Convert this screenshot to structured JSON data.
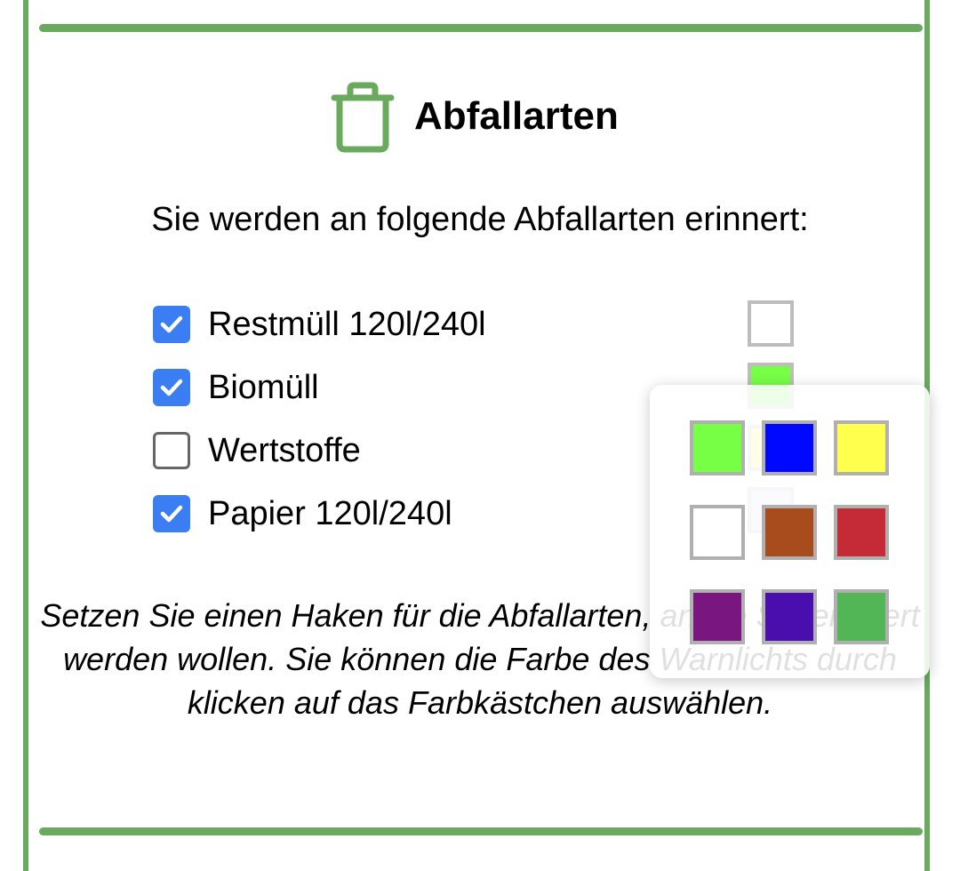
{
  "header": {
    "title": "Abfallarten",
    "icon": "trash-icon"
  },
  "subtitle": "Sie werden an folgende Abfallarten erinnert:",
  "waste_types": [
    {
      "label": "Restmüll 120l/240l",
      "checked": true,
      "color": "#ffffff"
    },
    {
      "label": "Biomüll",
      "checked": true,
      "color": "#76ff45"
    },
    {
      "label": "Wertstoffe",
      "checked": false,
      "color": "#ffff4d"
    },
    {
      "label": "Papier 120l/240l",
      "checked": true,
      "color": "#d6d6ff"
    }
  ],
  "hint": "Setzen Sie einen Haken für die Abfallarten, an die Sie erinnert werden wollen. Sie können die Farbe des Warnlichts durch klicken auf das Farbkästchen auswählen.",
  "color_picker": {
    "colors": [
      "#76ff45",
      "#0008ff",
      "#ffff4d",
      "#ffffff",
      "#a84c1e",
      "#c52a37",
      "#7a1680",
      "#4a0eae",
      "#52b556"
    ]
  },
  "theme": {
    "accent": "#6aaa5e",
    "checkbox": "#3b7ef3"
  }
}
